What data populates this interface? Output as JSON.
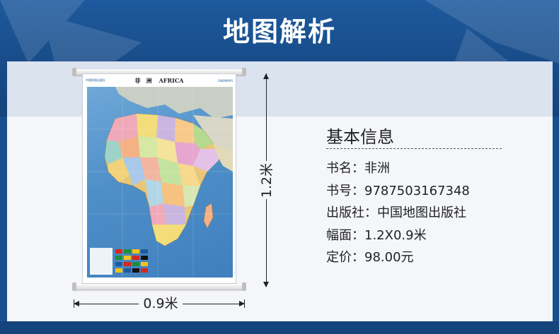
{
  "header": {
    "title": "地图解析"
  },
  "poster": {
    "title_cn": "非　洲",
    "title_en": "AFRICA",
    "publisher_mark": "中国地图出版社",
    "logo_mark": "SINOMAPS"
  },
  "dimensions": {
    "height_label": "1.2米",
    "width_label": "0.9米"
  },
  "info": {
    "title": "基本信息",
    "rows": [
      {
        "label": "书名：",
        "value": "非洲"
      },
      {
        "label": "书号：",
        "value": "9787503167348"
      },
      {
        "label": "出版社：",
        "value": "中国地图出版社"
      },
      {
        "label": "幅面：",
        "value": "1.2X0.9米"
      },
      {
        "label": "定价：",
        "value": "98.00元"
      }
    ]
  },
  "colors": {
    "brand_blue": "#1e5a9e",
    "panel_bg": "#f4f6f9",
    "stripe": "#dbe3ef"
  }
}
